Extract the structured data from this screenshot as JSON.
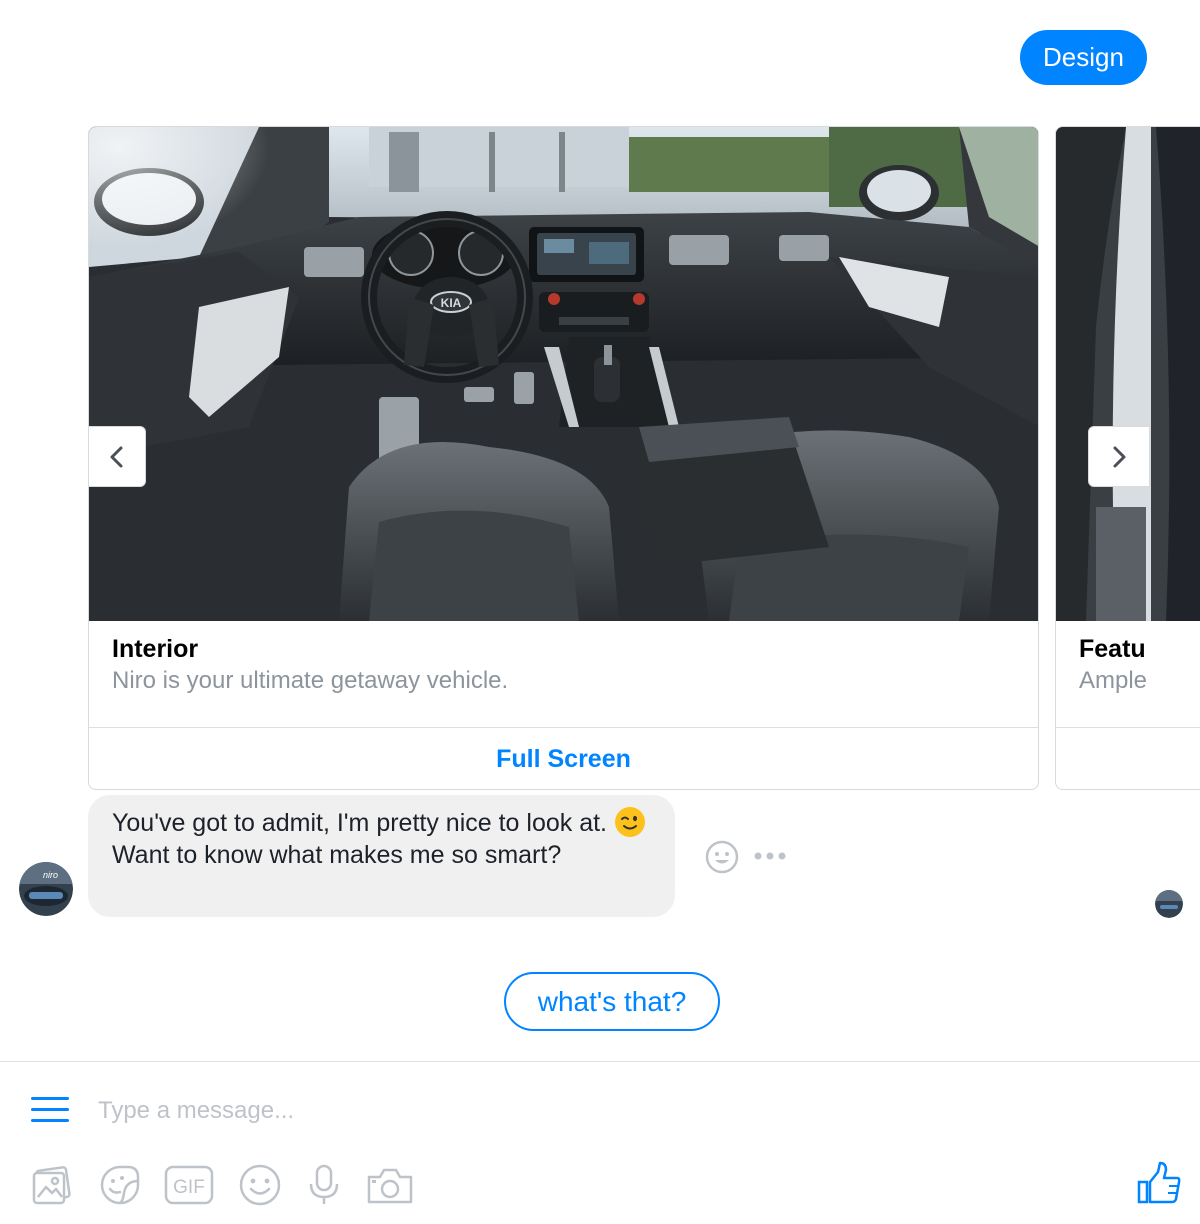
{
  "conversation": {
    "user_message": "Design",
    "bot_message_part1": "You've got to admit, I'm pretty nice to look at.",
    "bot_message_part2": "Want to know what makes me so smart?"
  },
  "carousel": {
    "cards": [
      {
        "title": "Interior",
        "subtitle": "Niro is your ultimate getaway vehicle.",
        "button_label": "Full Screen"
      },
      {
        "title": "Featu",
        "subtitle": "Ample"
      }
    ],
    "brand_logo_text": "KIA",
    "avatar_text": "niro"
  },
  "quick_replies": [
    "what's that?"
  ],
  "composer": {
    "placeholder": "Type a message...",
    "gif_label": "GIF"
  },
  "icons": {
    "prev": "chevron-left-icon",
    "next": "chevron-right-icon",
    "react": "smiley-icon",
    "more": "more-dots-icon",
    "menu": "hamburger-icon",
    "gallery": "image-icon",
    "sticker": "sticker-icon",
    "gif": "gif-icon",
    "emoji": "emoji-icon",
    "microphone": "microphone-icon",
    "camera": "camera-icon",
    "like": "thumbs-up-icon",
    "wink": "winking-face-icon"
  },
  "colors": {
    "accent": "#0084ff",
    "bubble_gray": "#f1f0f0",
    "muted_text": "#8d949e",
    "icon_gray": "#bec3c9"
  }
}
